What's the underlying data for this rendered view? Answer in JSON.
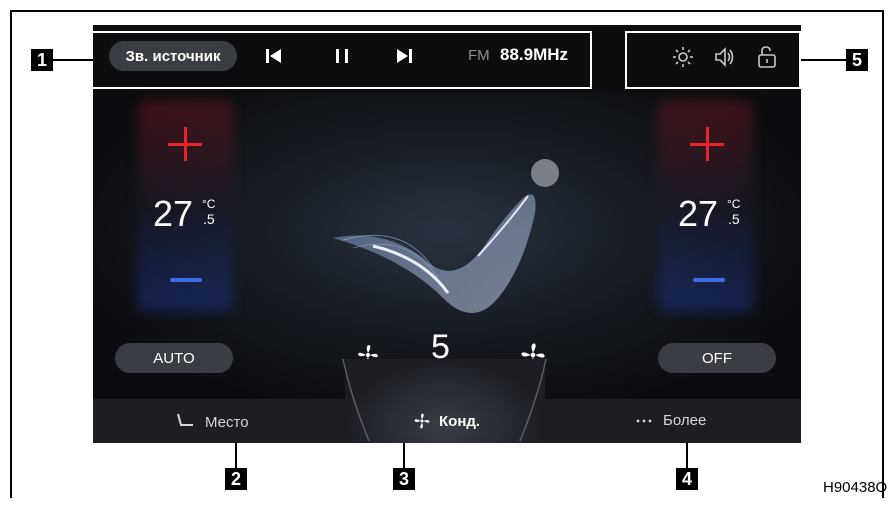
{
  "top_bar": {
    "source_button": "Зв. источник",
    "radio_band": "FM",
    "radio_frequency": "88.9MHz"
  },
  "climate": {
    "left_temp_whole": "27",
    "left_temp_unit": "°C",
    "left_temp_decimal": ".5",
    "right_temp_whole": "27",
    "right_temp_unit": "°C",
    "right_temp_decimal": ".5",
    "auto_label": "AUTO",
    "off_label": "OFF",
    "fan_speed": "5"
  },
  "tabs": {
    "seat": "Место",
    "ac": "Конд.",
    "more": "Более"
  },
  "callouts": [
    "1",
    "2",
    "3",
    "4",
    "5"
  ],
  "figure_code": "H90438O",
  "colors": {
    "accent_red": "#e8242a",
    "accent_blue": "#3e6ce0",
    "pill_bg": "#3b3d44"
  }
}
